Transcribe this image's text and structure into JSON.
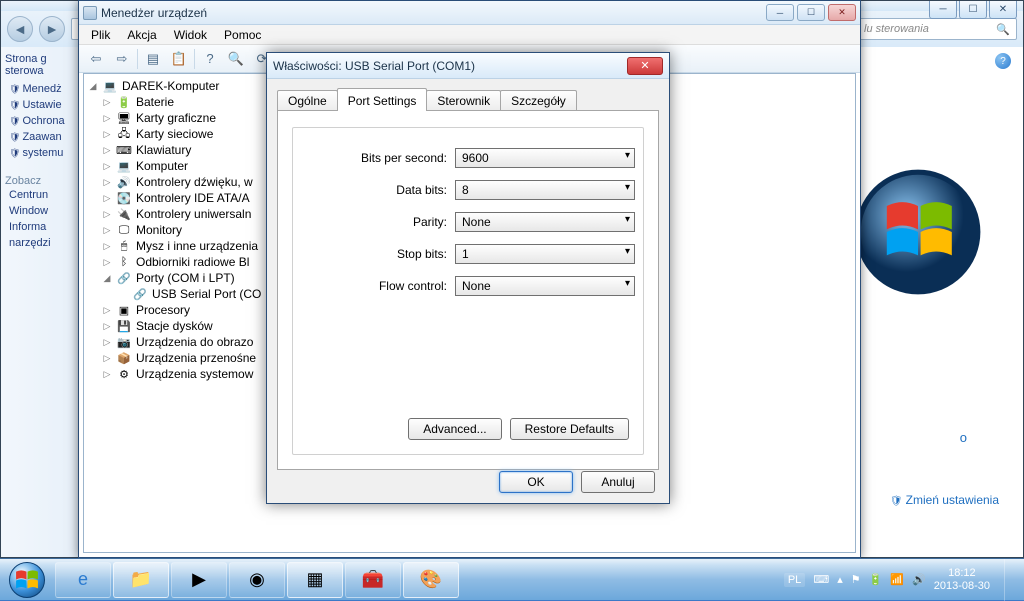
{
  "cp": {
    "addr_hint": "lu sterowania",
    "search_icon": "🔍",
    "side_header1": "Strona g",
    "side_header2": "sterowa",
    "side_items": [
      "Menedż",
      "Ustawie",
      "Ochrona",
      "Zaawan",
      "systemu"
    ],
    "side_sect": "Zobacz",
    "side_foot": [
      "Centrun",
      "Window",
      "Informa",
      "narzędzi"
    ],
    "change_link": "Zmień ustawienia",
    "tooltip_o": "o"
  },
  "dm": {
    "title": "Menedżer urządzeń",
    "menu": [
      "Plik",
      "Akcja",
      "Widok",
      "Pomoc"
    ],
    "root": "DAREK-Komputer",
    "items": [
      {
        "icon": "🔋",
        "label": "Baterie"
      },
      {
        "icon": "🖥",
        "label": "Karty graficzne"
      },
      {
        "icon": "🖧",
        "label": "Karty sieciowe"
      },
      {
        "icon": "⌨",
        "label": "Klawiatury"
      },
      {
        "icon": "💻",
        "label": "Komputer"
      },
      {
        "icon": "🔊",
        "label": "Kontrolery dźwięku, w"
      },
      {
        "icon": "💽",
        "label": "Kontrolery IDE ATA/A"
      },
      {
        "icon": "🔌",
        "label": "Kontrolery uniwersaln"
      },
      {
        "icon": "🖵",
        "label": "Monitory"
      },
      {
        "icon": "🖱",
        "label": "Mysz i inne urządzenia"
      },
      {
        "icon": "ᛒ",
        "label": "Odbiorniki radiowe Bl"
      },
      {
        "icon": "🔗",
        "label": "Porty (COM i LPT)",
        "expanded": true,
        "child": {
          "icon": "🔗",
          "label": "USB Serial Port (CO"
        }
      },
      {
        "icon": "▣",
        "label": "Procesory"
      },
      {
        "icon": "💾",
        "label": "Stacje dysków"
      },
      {
        "icon": "📷",
        "label": "Urządzenia do obrazo"
      },
      {
        "icon": "📦",
        "label": "Urządzenia przenośne"
      },
      {
        "icon": "⚙",
        "label": "Urządzenia systemow"
      }
    ]
  },
  "prop": {
    "title": "Właściwości: USB Serial Port (COM1)",
    "tabs": [
      "Ogólne",
      "Port Settings",
      "Sterownik",
      "Szczegóły"
    ],
    "active_tab": 1,
    "rows": [
      {
        "label": "Bits per second:",
        "value": "9600"
      },
      {
        "label": "Data bits:",
        "value": "8"
      },
      {
        "label": "Parity:",
        "value": "None"
      },
      {
        "label": "Stop bits:",
        "value": "1"
      },
      {
        "label": "Flow control:",
        "value": "None"
      }
    ],
    "advanced": "Advanced...",
    "restore": "Restore Defaults",
    "ok": "OK",
    "cancel": "Anuluj"
  },
  "tb": {
    "lang": "PL",
    "time": "18:12",
    "date": "2013-08-30"
  }
}
